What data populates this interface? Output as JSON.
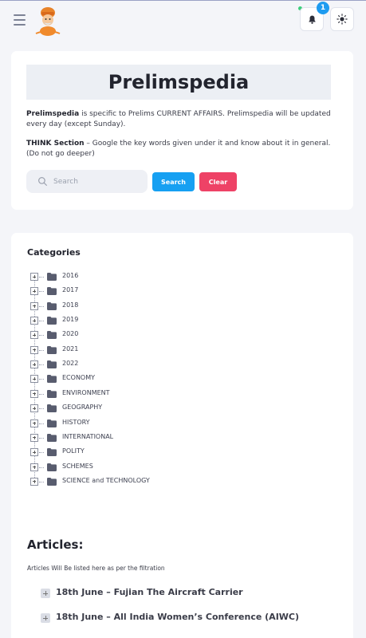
{
  "header": {
    "notification_count": "1",
    "logo_icon": "mascot-logo",
    "menu_icon": "hamburger-icon",
    "bell_icon": "bell-icon",
    "theme_icon": "sun-icon",
    "online_color": "#3ccf7b",
    "badge_color": "#1d9bf0"
  },
  "intro": {
    "title": "Prelimspedia",
    "desc1_bold": "Prelimspedia",
    "desc1_text": " is specific to Prelims CURRENT AFFAIRS. Prelimspedia will be updated every day (except Sunday).",
    "desc2_bold": "THINK Section",
    "desc2_text": " – Google the key words given under it and know about it in general. (Do not go deeper)"
  },
  "search": {
    "placeholder": "Search",
    "value": "",
    "search_label": "Search",
    "clear_label": "Clear",
    "search_color": "#16a0f2",
    "clear_color": "#ee4266"
  },
  "categories": {
    "title": "Categories",
    "items": [
      {
        "label": "2016"
      },
      {
        "label": "2017"
      },
      {
        "label": "2018"
      },
      {
        "label": "2019"
      },
      {
        "label": "2020"
      },
      {
        "label": "2021"
      },
      {
        "label": "2022"
      },
      {
        "label": "ECONOMY"
      },
      {
        "label": "ENVIRONMENT"
      },
      {
        "label": "GEOGRAPHY"
      },
      {
        "label": "HISTORY"
      },
      {
        "label": "INTERNATIONAL"
      },
      {
        "label": "POLITY"
      },
      {
        "label": "SCHEMES"
      },
      {
        "label": "SCIENCE and TECHNOLOGY"
      }
    ]
  },
  "articles": {
    "title": "Articles:",
    "note": "Articles Will Be listed here as per the filtration",
    "items": [
      {
        "label": "18th June – Fujian The Aircraft Carrier"
      },
      {
        "label": "18th June – All India Women’s Conference (AIWC)"
      }
    ]
  }
}
